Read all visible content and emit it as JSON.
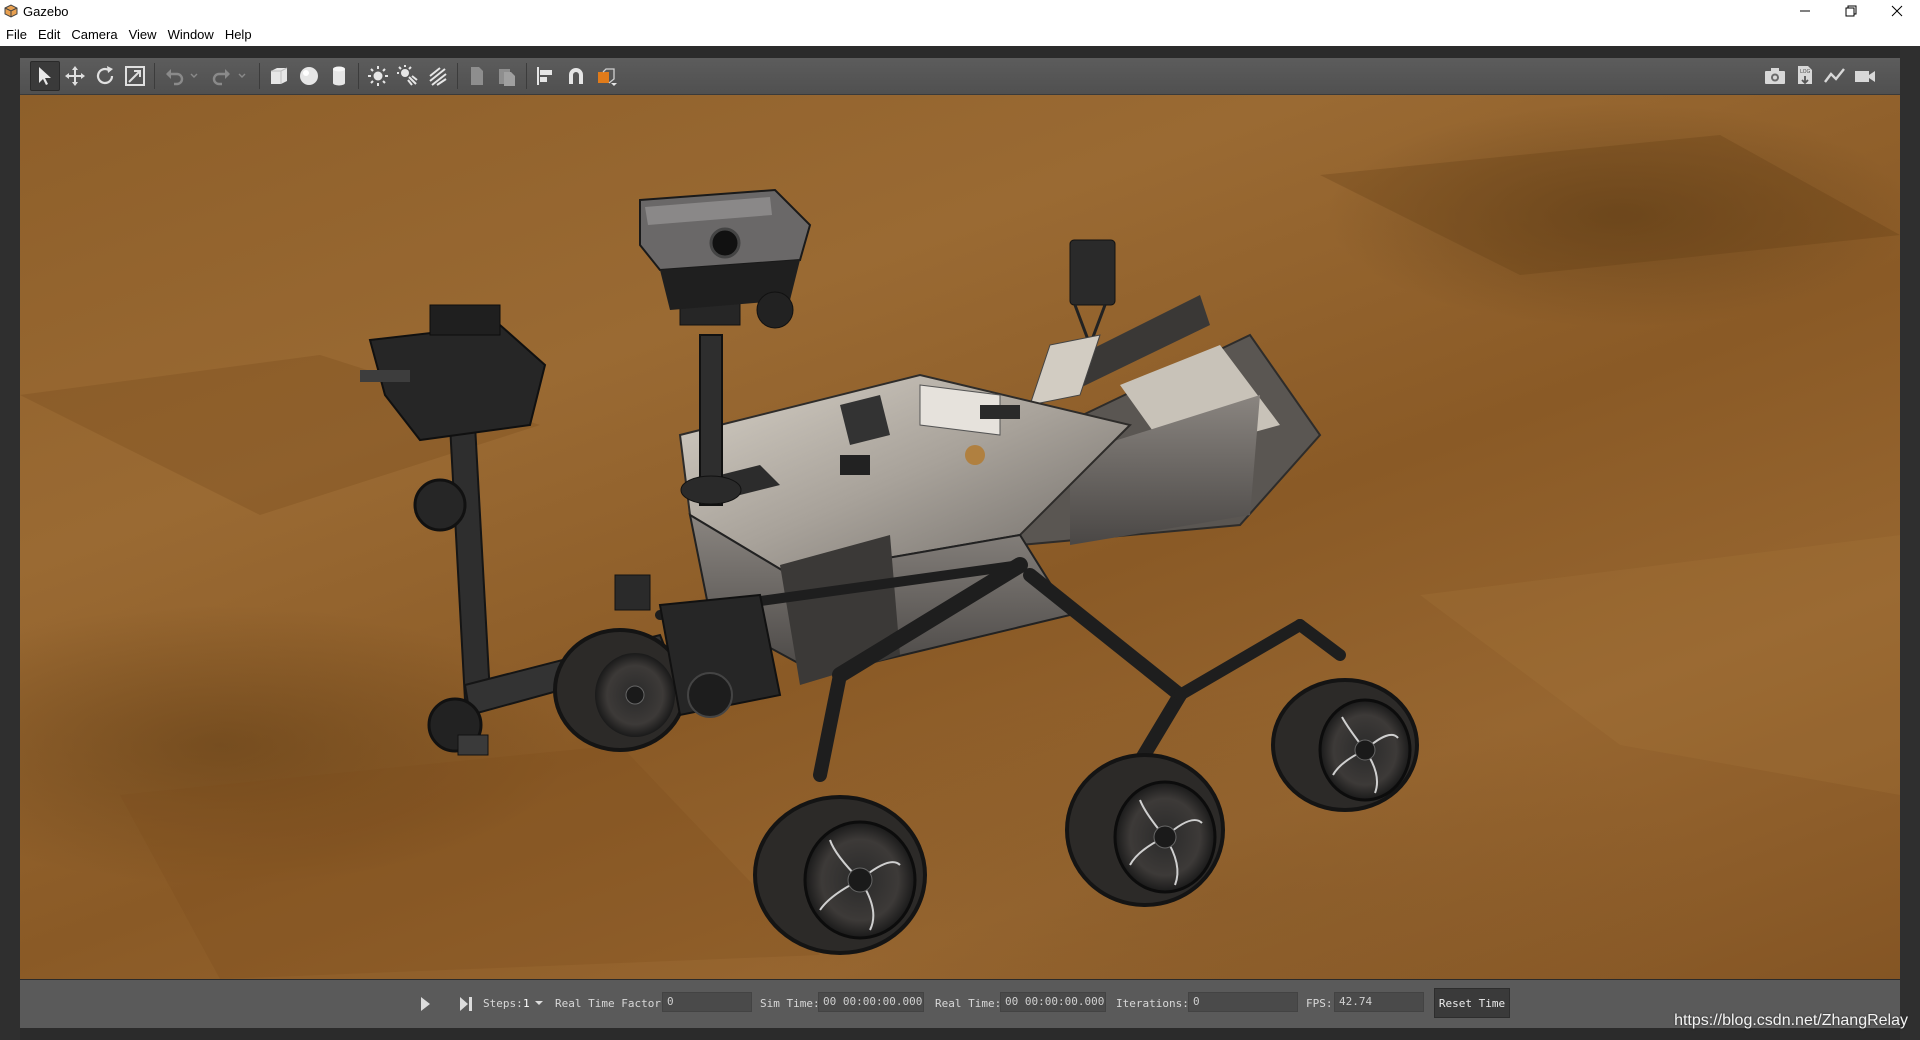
{
  "window": {
    "title": "Gazebo"
  },
  "menu": [
    "File",
    "Edit",
    "Camera",
    "View",
    "Window",
    "Help"
  ],
  "toolbar": {
    "left_icons": [
      "select-arrow-icon",
      "translate-icon",
      "rotate-icon",
      "scale-icon",
      "undo-icon",
      "redo-icon",
      "box-icon",
      "sphere-icon",
      "cylinder-icon",
      "point-light-icon",
      "spot-light-icon",
      "directional-light-icon",
      "copy-icon",
      "paste-icon",
      "align-icon",
      "snap-magnet-icon",
      "change-view-icon"
    ],
    "right_icons": [
      "screenshot-camera-icon",
      "log-icon",
      "plot-icon",
      "video-record-icon"
    ]
  },
  "bottom": {
    "steps_label": "Steps:",
    "steps_value": "1",
    "rtf_label": "Real Time Factor:",
    "rtf_value": "0",
    "sim_time_label": "Sim Time:",
    "sim_time_value": "00 00:00:00.000",
    "real_time_label": "Real Time:",
    "real_time_value": "00 00:00:00.000",
    "iterations_label": "Iterations:",
    "iterations_value": "0",
    "fps_label": "FPS:",
    "fps_value": "42.74",
    "reset_label": "Reset Time"
  },
  "watermark": "https://blog.csdn.net/ZhangRelay",
  "colors": {
    "ground": "#8e5f2a",
    "toolbar": "#555555",
    "frame": "#2b2b2b",
    "accent_orange": "#e07b1a"
  }
}
